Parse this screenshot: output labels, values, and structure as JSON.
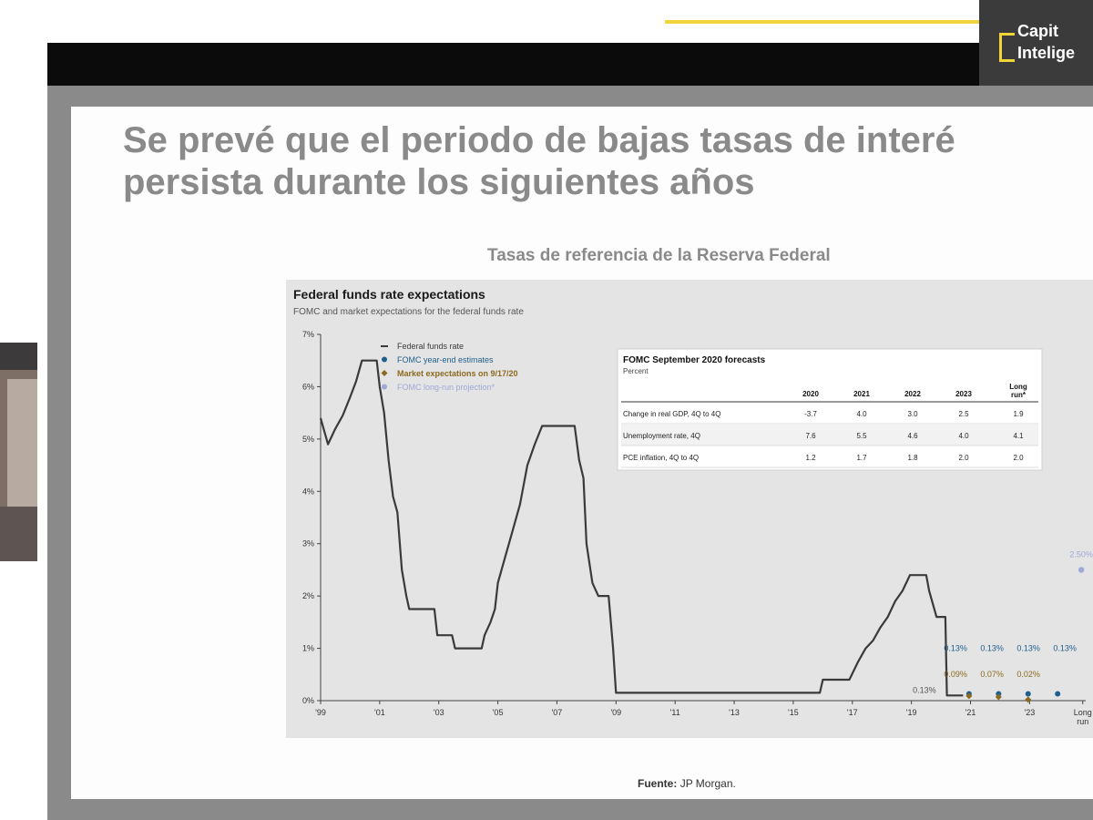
{
  "logo": {
    "line1": "Capit",
    "line2": "Intelige"
  },
  "slide": {
    "title_line1": "Se prevé que el periodo de bajas tasas de interé",
    "title_line2": "persista durante los siguientes años",
    "subtitle": "Tasas de referencia de la Reserva Federal",
    "source_label": "Fuente:",
    "source_value": "JP Morgan."
  },
  "colors": {
    "rate_line": "#3a3a3a",
    "fomc_estimates": "#1f5f8b",
    "market_expectations": "#8b6a1f",
    "long_run": "#9fa8d8",
    "accent_yellow": "#f0d43a"
  },
  "chart_data": {
    "type": "line",
    "title": "Federal funds rate expectations",
    "subtitle": "FOMC and market expectations for the federal funds rate",
    "y_ticks": [
      "0%",
      "1%",
      "2%",
      "3%",
      "4%",
      "5%",
      "6%",
      "7%"
    ],
    "x_ticks": [
      "'99",
      "'01",
      "'03",
      "'05",
      "'07",
      "'09",
      "'11",
      "'13",
      "'15",
      "'17",
      "'19",
      "'21",
      "'23",
      "Long run"
    ],
    "ylim": [
      0,
      7
    ],
    "xlim": [
      1999,
      2024.9
    ],
    "legend": [
      {
        "label": "Federal funds rate",
        "marker": "line",
        "color": "#3a3a3a"
      },
      {
        "label": "FOMC year-end estimates",
        "marker": "dot",
        "color": "#1f5f8b"
      },
      {
        "label": "Market expectations on 9/17/20",
        "marker": "diamond",
        "color": "#8b6a1f"
      },
      {
        "label": "FOMC long-run projection*",
        "marker": "dot",
        "color": "#9fa8d8"
      }
    ],
    "series": [
      {
        "name": "Federal funds rate",
        "points": [
          [
            1999.0,
            5.4
          ],
          [
            1999.25,
            4.9
          ],
          [
            1999.5,
            5.2
          ],
          [
            1999.75,
            5.45
          ],
          [
            2000.0,
            5.8
          ],
          [
            2000.2,
            6.1
          ],
          [
            2000.4,
            6.5
          ],
          [
            2000.9,
            6.5
          ],
          [
            2001.0,
            6.0
          ],
          [
            2001.15,
            5.5
          ],
          [
            2001.3,
            4.6
          ],
          [
            2001.45,
            3.9
          ],
          [
            2001.6,
            3.6
          ],
          [
            2001.75,
            2.5
          ],
          [
            2001.9,
            2.0
          ],
          [
            2002.0,
            1.75
          ],
          [
            2002.85,
            1.75
          ],
          [
            2002.95,
            1.25
          ],
          [
            2003.45,
            1.25
          ],
          [
            2003.55,
            1.0
          ],
          [
            2004.45,
            1.0
          ],
          [
            2004.55,
            1.25
          ],
          [
            2004.75,
            1.5
          ],
          [
            2004.9,
            1.75
          ],
          [
            2005.0,
            2.25
          ],
          [
            2005.25,
            2.75
          ],
          [
            2005.5,
            3.25
          ],
          [
            2005.75,
            3.75
          ],
          [
            2006.0,
            4.5
          ],
          [
            2006.25,
            4.9
          ],
          [
            2006.5,
            5.25
          ],
          [
            2007.6,
            5.25
          ],
          [
            2007.75,
            4.6
          ],
          [
            2007.9,
            4.25
          ],
          [
            2008.0,
            3.0
          ],
          [
            2008.2,
            2.25
          ],
          [
            2008.4,
            2.0
          ],
          [
            2008.75,
            2.0
          ],
          [
            2008.9,
            1.0
          ],
          [
            2009.0,
            0.15
          ],
          [
            2015.9,
            0.15
          ],
          [
            2016.0,
            0.4
          ],
          [
            2016.9,
            0.4
          ],
          [
            2017.2,
            0.75
          ],
          [
            2017.45,
            1.0
          ],
          [
            2017.7,
            1.15
          ],
          [
            2017.95,
            1.4
          ],
          [
            2018.2,
            1.6
          ],
          [
            2018.45,
            1.9
          ],
          [
            2018.7,
            2.1
          ],
          [
            2018.95,
            2.4
          ],
          [
            2019.5,
            2.4
          ],
          [
            2019.6,
            2.1
          ],
          [
            2019.85,
            1.6
          ],
          [
            2020.15,
            1.6
          ],
          [
            2020.2,
            0.1
          ],
          [
            2020.75,
            0.1
          ]
        ]
      },
      {
        "name": "FOMC year-end estimates",
        "points": [
          [
            2020.95,
            0.13
          ],
          [
            2021.95,
            0.13
          ],
          [
            2022.95,
            0.13
          ],
          [
            2023.95,
            0.13
          ]
        ],
        "labels": [
          "0.13%",
          "0.13%",
          "0.13%",
          "0.13%"
        ]
      },
      {
        "name": "Market expectations on 9/17/20",
        "points": [
          [
            2020.95,
            0.09
          ],
          [
            2021.95,
            0.07
          ],
          [
            2022.95,
            0.02
          ]
        ],
        "labels": [
          "0.09%",
          "0.07%",
          "0.02%"
        ]
      },
      {
        "name": "FOMC long-run projection*",
        "points": [
          [
            2024.75,
            2.5
          ]
        ],
        "labels": [
          "2.50%"
        ]
      }
    ],
    "current_rate_label": "0.13%",
    "table": {
      "title": "FOMC September 2020 forecasts",
      "subtitle": "Percent",
      "headers": [
        "",
        "2020",
        "2021",
        "2022",
        "2023",
        "Long run*"
      ],
      "rows": [
        [
          "Change in real GDP, 4Q to 4Q",
          "-3.7",
          "4.0",
          "3.0",
          "2.5",
          "1.9"
        ],
        [
          "Unemployment rate, 4Q",
          "7.6",
          "5.5",
          "4.6",
          "4.0",
          "4.1"
        ],
        [
          "PCE inflation, 4Q to 4Q",
          "1.2",
          "1.7",
          "1.8",
          "2.0",
          "2.0"
        ]
      ]
    }
  }
}
